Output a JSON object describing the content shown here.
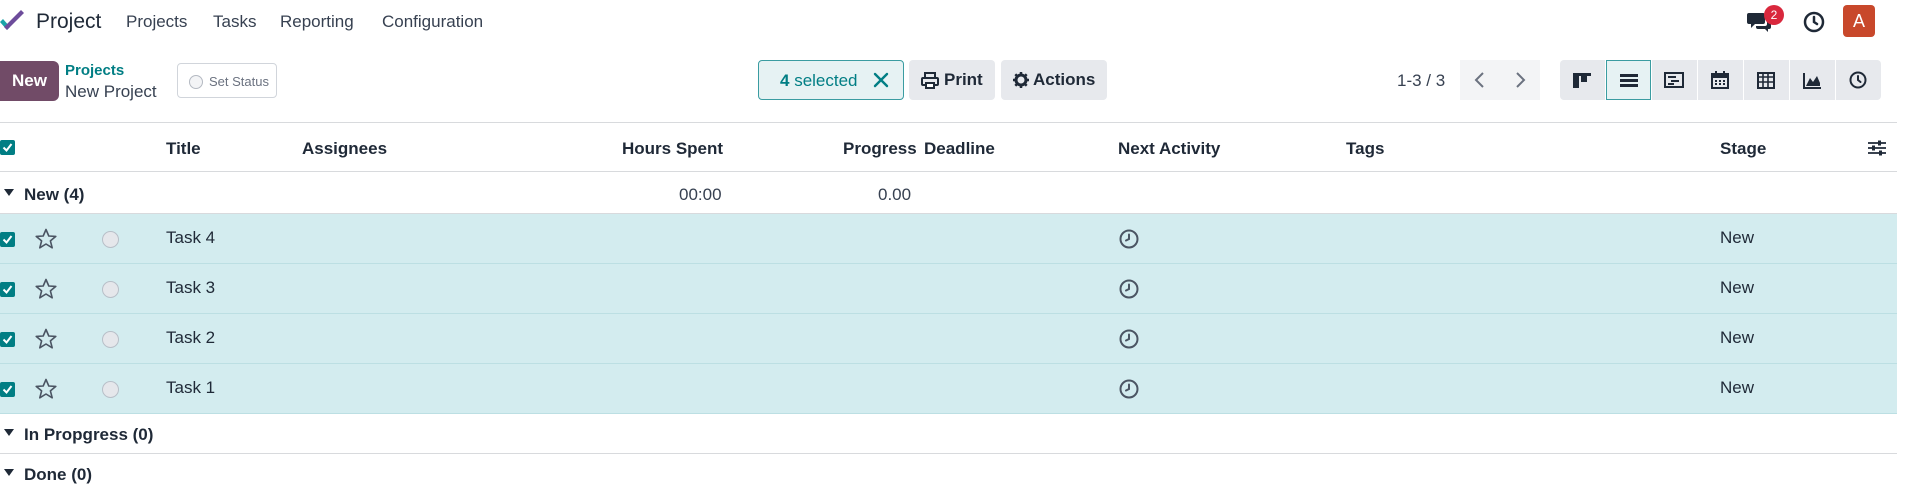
{
  "app": {
    "title": "Project"
  },
  "menu": [
    {
      "label": "Projects"
    },
    {
      "label": "Tasks"
    },
    {
      "label": "Reporting"
    },
    {
      "label": "Configuration"
    }
  ],
  "systray": {
    "chat_count": "2",
    "avatar_letter": "A"
  },
  "control_panel": {
    "new_label": "New",
    "breadcrumb_parent": "Projects",
    "breadcrumb_current": "New Project",
    "set_status_label": "Set Status",
    "selected_count": "4",
    "selected_suffix": " selected",
    "print_label": "Print",
    "actions_label": "Actions",
    "pager": "1-3 / 3"
  },
  "views": [
    "kanban-view",
    "list-view",
    "gantt-view",
    "calendar-view",
    "pivot-view",
    "graph-view",
    "activity-view"
  ],
  "table": {
    "columns": {
      "title": "Title",
      "assignees": "Assignees",
      "hours_spent": "Hours Spent",
      "progress": "Progress",
      "deadline": "Deadline",
      "next_activity": "Next Activity",
      "tags": "Tags",
      "stage": "Stage"
    },
    "groups": [
      {
        "label": "New (4)",
        "hours": "00:00",
        "progress": "0.00"
      },
      {
        "label": "In Propgress (0)"
      },
      {
        "label": "Done (0)"
      }
    ],
    "rows": [
      {
        "title": "Task 4",
        "stage": "New",
        "selected": true
      },
      {
        "title": "Task 3",
        "stage": "New",
        "selected": true
      },
      {
        "title": "Task 2",
        "stage": "New",
        "selected": true
      },
      {
        "title": "Task 1",
        "stage": "New",
        "selected": true
      }
    ]
  },
  "colors": {
    "brand": "#714b67",
    "accent": "#017e84",
    "selected_row": "#d3ecef",
    "badge": "#d9283d",
    "avatar": "#c8482b"
  }
}
